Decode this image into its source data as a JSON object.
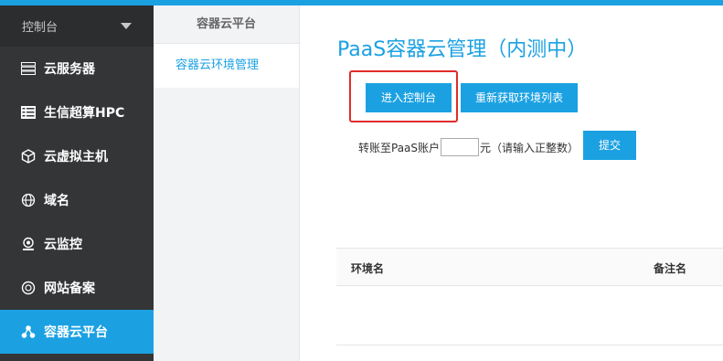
{
  "colors": {
    "accent": "#1ba1e2",
    "sidebar_bg": "#333537",
    "highlight": "#e02b2b"
  },
  "sidebar": {
    "header": "控制台",
    "items": [
      {
        "label": "云服务器",
        "icon": "server-icon"
      },
      {
        "label": "生信超算HPC",
        "icon": "list-icon"
      },
      {
        "label": "云虚拟主机",
        "icon": "cube-icon"
      },
      {
        "label": "域名",
        "icon": "globe-icon"
      },
      {
        "label": "云监控",
        "icon": "camera-icon"
      },
      {
        "label": "网站备案",
        "icon": "seal-icon"
      },
      {
        "label": "容器云平台",
        "icon": "cluster-icon",
        "active": true
      }
    ]
  },
  "subnav": {
    "title": "容器云平台",
    "items": [
      {
        "label": "容器云环境管理"
      }
    ]
  },
  "main": {
    "title": "PaaS容器云管理（内测中）",
    "enter_console_label": "进入控制台",
    "refresh_label": "重新获取环境列表",
    "transfer": {
      "prefix": "转账至PaaS账户",
      "input_value": "",
      "suffix": "元（请输入正整数）",
      "submit_label": "提交"
    },
    "table": {
      "columns": [
        "环境名",
        "备注名"
      ]
    }
  }
}
